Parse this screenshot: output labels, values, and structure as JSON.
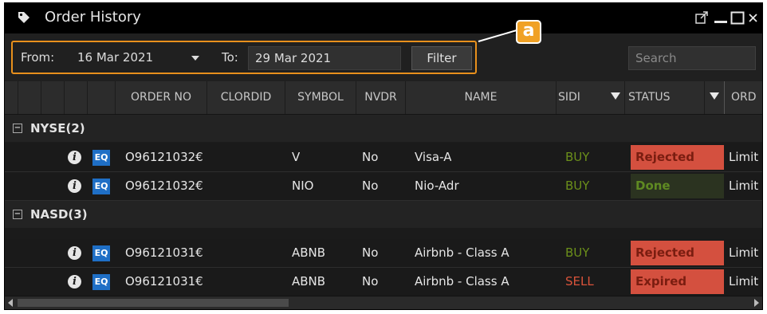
{
  "window": {
    "title": "Order History",
    "title_icon": "tag-icon",
    "controls": [
      "popout-icon",
      "minimize-icon",
      "maximize-icon",
      "close-icon"
    ]
  },
  "toolbar": {
    "from_label": "From:",
    "from_value": "16 Mar 2021",
    "to_label": "To:",
    "to_value": "29 Mar 2021",
    "filter_label": "Filter",
    "search_placeholder": "Search",
    "callout_label": "a"
  },
  "columns": {
    "order_no": "ORDER NO",
    "clordid": "CLORDID",
    "symbol": "SYMBOL",
    "nvdr": "NVDR",
    "name": "NAME",
    "side": "SIDI",
    "status": "STATUS",
    "ord": "ORD"
  },
  "groups": [
    {
      "label": "NYSE(2)",
      "rows": [
        {
          "type": "EQ",
          "order_no": "O96121032€",
          "symbol": "V",
          "nvdr": "No",
          "name": "Visa-A",
          "side": "BUY",
          "status": "Rejected",
          "ord": "Limit"
        },
        {
          "type": "EQ",
          "order_no": "O96121032€",
          "symbol": "NIO",
          "nvdr": "No",
          "name": "Nio-Adr",
          "side": "BUY",
          "status": "Done",
          "ord": "Limit"
        }
      ]
    },
    {
      "label": "NASD(3)",
      "rows": [
        {
          "type": "EQ",
          "order_no": "O96121031€",
          "symbol": "ABNB",
          "nvdr": "No",
          "name": "Airbnb - Class A",
          "side": "BUY",
          "status": "Rejected",
          "ord": "Limit"
        },
        {
          "type": "EQ",
          "order_no": "O96121031€",
          "symbol": "ABNB",
          "nvdr": "No",
          "name": "Airbnb - Class A",
          "side": "SELL",
          "status": "Expired",
          "ord": "Limit"
        }
      ]
    }
  ],
  "colors": {
    "accent_orange": "#e8901c",
    "buy": "#6b8f1a",
    "sell": "#d9533a",
    "rejected_bg": "#d4503f",
    "rejected_fg": "#7a1d10",
    "done_bg": "#2b3320",
    "done_fg": "#5f8a22",
    "eq_badge": "#1f6fc6"
  }
}
